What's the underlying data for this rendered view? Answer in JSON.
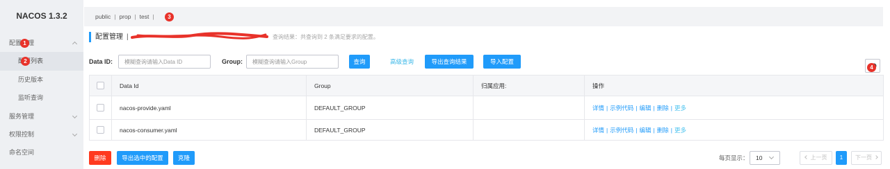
{
  "app": {
    "title": "NACOS 1.3.2"
  },
  "sidebar": {
    "items": [
      {
        "label": "配置管理",
        "icon": "chevron-up-icon",
        "expanded": true
      },
      {
        "label": "配置列表",
        "active": true
      },
      {
        "label": "历史版本"
      },
      {
        "label": "监听查询"
      },
      {
        "label": "服务管理",
        "icon": "chevron-down-icon",
        "expanded": false
      },
      {
        "label": "权限控制",
        "icon": "chevron-down-icon",
        "expanded": false
      },
      {
        "label": "命名空间"
      }
    ]
  },
  "annotations": [
    "1",
    "2",
    "3",
    "4"
  ],
  "namespace_bar": {
    "items": [
      "public",
      "prop",
      "test"
    ],
    "separator": "|"
  },
  "header": {
    "title": "配置管理",
    "separator": "|",
    "result_text": "查询结果：共查询到 2 条满足要求的配置。"
  },
  "search": {
    "data_id_label": "Data ID:",
    "data_id_placeholder": "模糊查询请输入Data ID",
    "data_id_value": "",
    "group_label": "Group:",
    "group_placeholder": "模糊查询请输入Group",
    "group_value": "",
    "query_button": "查询",
    "advanced_link": "高级查询",
    "export_button": "导出查询结果",
    "import_button": "导入配置",
    "tool_icon": "settings-icon"
  },
  "table": {
    "columns": [
      "Data Id",
      "Group",
      "归属应用:",
      "操作"
    ],
    "action_separator": "|",
    "rows": [
      {
        "data_id": "nacos-provide.yaml",
        "group": "DEFAULT_GROUP",
        "app": "",
        "actions": [
          "详情",
          "示例代码",
          "编辑",
          "删除",
          "更多"
        ]
      },
      {
        "data_id": "nacos-consumer.yaml",
        "group": "DEFAULT_GROUP",
        "app": "",
        "actions": [
          "详情",
          "示例代码",
          "编辑",
          "删除",
          "更多"
        ]
      }
    ]
  },
  "footer": {
    "delete_button": "删除",
    "export_selected_button": "导出选中的配置",
    "clone_button": "克隆"
  },
  "pagination": {
    "page_size_label": "每页显示：",
    "page_size": "10",
    "prev_label": "上一页",
    "next_label": "下一页",
    "current_page": "1",
    "prev_icon": "chevron-left-icon",
    "next_icon": "chevron-right-icon"
  },
  "colors": {
    "primary": "#209bfa",
    "danger": "#ff3a1f",
    "badge": "#e8322a",
    "link_light": "#3cb8e8",
    "sidebar_bg": "#eef0f3",
    "active_bg": "#e2e5ea"
  }
}
